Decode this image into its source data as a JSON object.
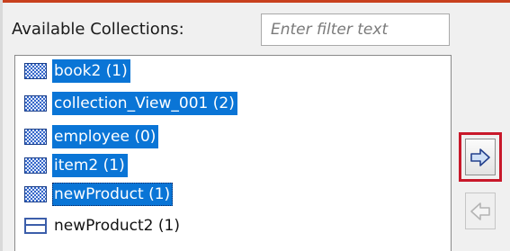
{
  "header": {
    "label": "Available Collections:"
  },
  "filter": {
    "placeholder": "Enter filter text",
    "value": ""
  },
  "collections": [
    {
      "label": "book2 (1)",
      "selected": true
    },
    {
      "label": "collection_View_001 (2)",
      "selected": true
    },
    {
      "label": "employee (0)",
      "selected": true
    },
    {
      "label": "item2 (1)",
      "selected": true
    },
    {
      "label": "newProduct (1)",
      "selected": true,
      "focused": true
    },
    {
      "label": "newProduct2 (1)",
      "selected": false
    }
  ],
  "buttons": {
    "add_icon": "arrow-right-icon",
    "add_enabled": true,
    "add_highlighted": true,
    "remove_icon": "arrow-left-icon",
    "remove_enabled": false
  },
  "colors": {
    "selection": "#0a75d6",
    "highlight_border": "#c8182a",
    "accent": "#c8401e"
  }
}
